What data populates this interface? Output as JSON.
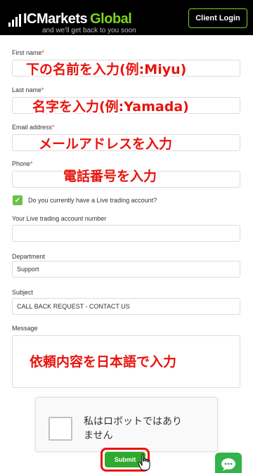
{
  "header": {
    "logo_ic": "IC",
    "logo_markets": "Markets",
    "logo_global": "Global",
    "client_login": "Client Login"
  },
  "top_text": "and we'll get back to you soon",
  "form": {
    "first_name_label": "First name",
    "last_name_label": "Last name",
    "email_label": "Email address",
    "phone_label": "Phone",
    "required_mark": "*",
    "live_account_question": "Do you currently have a Live trading account?",
    "live_account_number_label": "Your Live trading account number",
    "department_label": "Department",
    "department_value": "Support",
    "subject_label": "Subject",
    "subject_value": "CALL BACK REQUEST - CONTACT US",
    "message_label": "Message",
    "submit_label": "Submit"
  },
  "captcha": {
    "text": "私はロボットではあり\nません"
  },
  "annotations": {
    "first_name": "下の名前を入力(例:Miyu)",
    "last_name": "名字を入力(例:Yamada)",
    "email": "メールアドレスを入力",
    "phone": "電話番号を入力",
    "message": "依頼内容を日本語で入力"
  },
  "colors": {
    "header_bg": "#000000",
    "brand_green": "#7ed321",
    "annotation_red": "#e8140d",
    "submit_green": "#2eaa2e"
  }
}
